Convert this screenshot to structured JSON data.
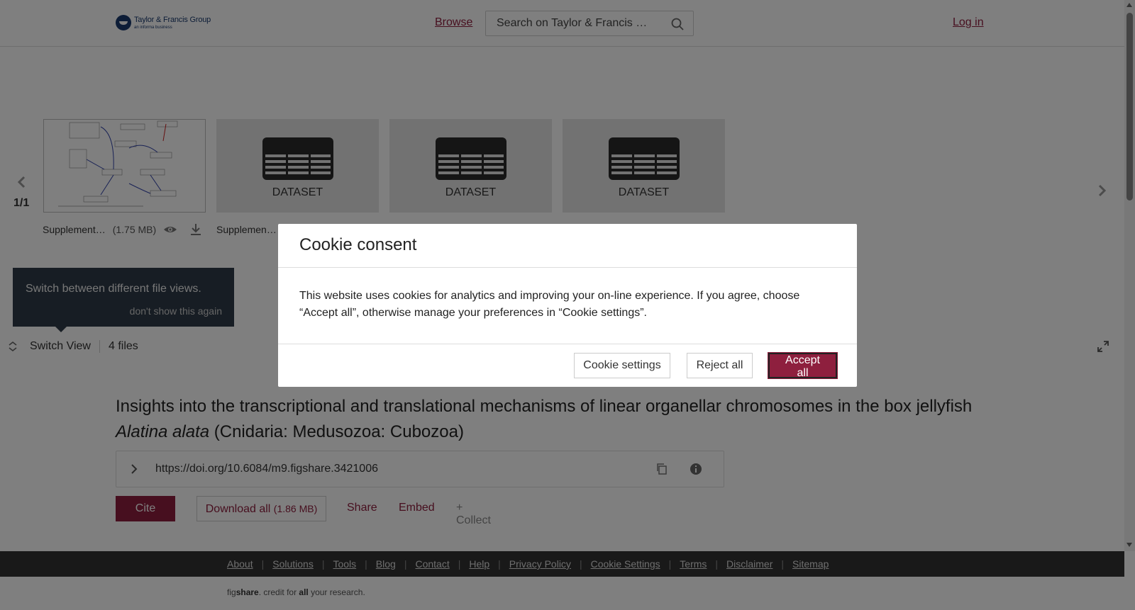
{
  "header": {
    "logo_name": "Taylor & Francis Group",
    "logo_sub": "an informa business",
    "browse_label": "Browse",
    "search_placeholder": "Search on Taylor & Francis …",
    "login_label": "Log in"
  },
  "viewer": {
    "page_counter": "1/1",
    "files": [
      {
        "type": "thumbnail",
        "name": "Supplement…",
        "size": "(1.75 MB)"
      },
      {
        "type": "dataset",
        "label": "DATASET",
        "name": "Supplemen…"
      },
      {
        "type": "dataset",
        "label": "DATASET"
      },
      {
        "type": "dataset",
        "label": "DATASET"
      }
    ],
    "tooltip": {
      "text": "Switch between different file views.",
      "dismiss": "don't show this again"
    },
    "switch_view_label": "Switch View",
    "files_count": "4 files"
  },
  "article": {
    "title_line1": "Insights into the transcriptional and translational mechanisms of linear organellar chromosomes in the box jellyfish",
    "title_species": "Alatina alata",
    "title_rest": " (Cnidaria: Medusozoa: Cubozoa)",
    "doi": "https://doi.org/10.6084/m9.figshare.3421006"
  },
  "actions": {
    "cite": "Cite",
    "download_all": "Download all",
    "download_size": "(1.86 MB)",
    "share": "Share",
    "embed": "Embed",
    "collect": "+ Collect"
  },
  "footer": {
    "links": [
      "About",
      "Solutions",
      "Tools",
      "Blog",
      "Contact",
      "Help",
      "Privacy Policy",
      "Cookie Settings",
      "Terms",
      "Disclaimer",
      "Sitemap"
    ],
    "tag_prefix": "fig",
    "tag_brand": "share",
    "tag_middle": ". credit for ",
    "tag_all": "all",
    "tag_end": " your research."
  },
  "cookie_modal": {
    "title": "Cookie consent",
    "body": "This website uses cookies for analytics and improving your on-line experience. If you agree, choose “Accept all”, otherwise manage your preferences in “Cookie settings”.",
    "settings_label": "Cookie settings",
    "reject_label": "Reject all",
    "accept_label": "Accept all"
  },
  "colors": {
    "brand": "#8e1f3e",
    "tooltip_bg": "#2f3b48",
    "footer_bg": "#333333"
  }
}
